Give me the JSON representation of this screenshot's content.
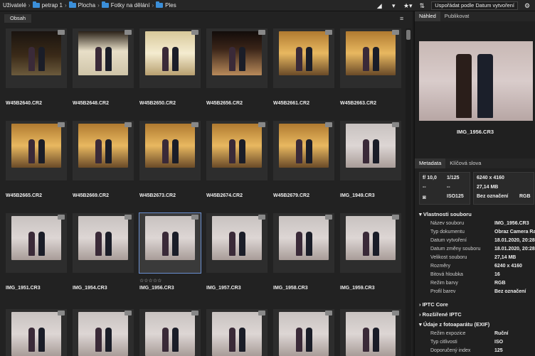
{
  "breadcrumb": [
    "Uživatelé",
    "petrap 1",
    "Plocha",
    "Fotky na dělání",
    "Ples"
  ],
  "toolbar": {
    "sort_label": "Uspořádat podle Datum vytvoření",
    "icons": [
      "triangle-up-icon",
      "triangle-down-icon",
      "star-filter-icon",
      "sort-arrows-icon",
      "gear-icon"
    ]
  },
  "left_panel": {
    "tab": "Obsah"
  },
  "thumbnails": [
    {
      "name": "W45B2640.CR2",
      "tone": "t-dark"
    },
    {
      "name": "W45B2648.CR2",
      "tone": "t-stage"
    },
    {
      "name": "W45B2650.CR2",
      "tone": "t-hall"
    },
    {
      "name": "W45B2656.CR2",
      "tone": "t-red"
    },
    {
      "name": "W45B2661.CR2",
      "tone": "t-gold"
    },
    {
      "name": "W45B2663.CR2",
      "tone": "t-gold"
    },
    {
      "name": "W45B2665.CR2",
      "tone": "t-gold"
    },
    {
      "name": "W45B2669.CR2",
      "tone": "t-gold"
    },
    {
      "name": "W45B2673.CR2",
      "tone": "t-gold"
    },
    {
      "name": "W45B2674.CR2",
      "tone": "t-gold"
    },
    {
      "name": "W45B2679.CR2",
      "tone": "t-gold"
    },
    {
      "name": "IMG_1949.CR3",
      "tone": "t-gray"
    },
    {
      "name": "IMG_1951.CR3",
      "tone": "t-gray"
    },
    {
      "name": "IMG_1954.CR3",
      "tone": "t-gray"
    },
    {
      "name": "IMG_1956.CR3",
      "tone": "t-gray",
      "selected": true,
      "rating": "☆☆☆☆☆"
    },
    {
      "name": "IMG_1957.CR3",
      "tone": "t-gray"
    },
    {
      "name": "IMG_1958.CR3",
      "tone": "t-gray"
    },
    {
      "name": "IMG_1959.CR3",
      "tone": "t-gray"
    },
    {
      "name": "",
      "tone": "t-gray"
    },
    {
      "name": "",
      "tone": "t-gray"
    },
    {
      "name": "",
      "tone": "t-gray"
    },
    {
      "name": "",
      "tone": "t-gray"
    },
    {
      "name": "",
      "tone": "t-gray"
    },
    {
      "name": "",
      "tone": "t-gray"
    }
  ],
  "right_panel": {
    "tabs": [
      "Náhled",
      "Publikovat"
    ],
    "preview_name": "IMG_1956.CR3",
    "meta_tabs": [
      "Metadata",
      "Klíčová slova"
    ],
    "summary": {
      "aperture": "f/ 10,0",
      "shutter": "1/125",
      "exposure_comp": "--",
      "flash": "--",
      "iso": "ISO125",
      "dimensions": "6240 x 4160",
      "size": "27,14 MB",
      "label": "Bez označení",
      "color_mode": "RGB"
    },
    "file_props_title": "Vlastnosti souboru",
    "file_props": [
      {
        "k": "Název souboru",
        "v": "IMG_1956.CR3"
      },
      {
        "k": "Typ dokumentu",
        "v": "Obraz Camera Raw"
      },
      {
        "k": "Datum vytvoření",
        "v": "18.01.2020, 20:28"
      },
      {
        "k": "Datum změny souboru",
        "v": "18.01.2020, 20:28"
      },
      {
        "k": "Velikost souboru",
        "v": "27,14 MB"
      },
      {
        "k": "Rozměry",
        "v": "6240 x 4160"
      },
      {
        "k": "Bitová hloubka",
        "v": "16"
      },
      {
        "k": "Režim barvy",
        "v": "RGB"
      },
      {
        "k": "Profil barev",
        "v": "Bez označení"
      }
    ],
    "sections": [
      "IPTC Core",
      "Rozšířené IPTC",
      "Údaje z fotoaparátu (EXIF)"
    ],
    "exif": [
      {
        "k": "Režim expozice",
        "v": "Ruční"
      },
      {
        "k": "Typ citlivosti",
        "v": "ISO"
      },
      {
        "k": "Doporučený index",
        "v": "125"
      }
    ]
  }
}
